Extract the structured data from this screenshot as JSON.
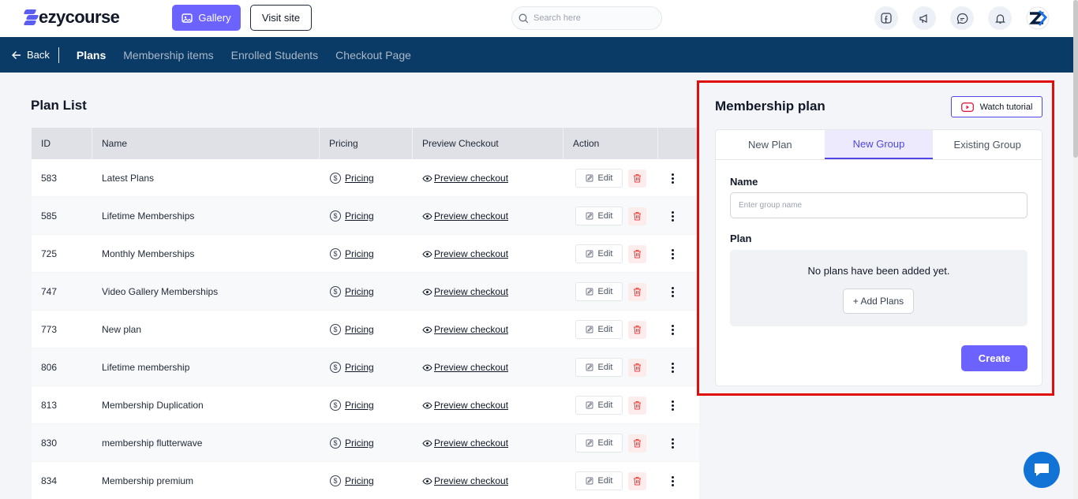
{
  "brand": {
    "logo_text": "ezycourse",
    "accent": "#6c63ff",
    "nav_bg": "#0a3a66",
    "highlight": "#e00d0d"
  },
  "header": {
    "gallery_label": "Gallery",
    "visit_label": "Visit site",
    "search_placeholder": "Search here",
    "icons": [
      "facebook-icon",
      "megaphone-icon",
      "messenger-icon",
      "bell-icon",
      "avatar"
    ]
  },
  "subnav": {
    "back_label": "Back",
    "tabs": [
      "Plans",
      "Membership items",
      "Enrolled Students",
      "Checkout Page"
    ],
    "active": "Plans"
  },
  "plan_list": {
    "title": "Plan List",
    "columns": [
      "ID",
      "Name",
      "Pricing",
      "Preview Checkout",
      "Action"
    ],
    "pricing_label": "Pricing",
    "preview_label": "Preview checkout",
    "edit_label": "Edit",
    "rows": [
      {
        "id": "583",
        "name": "Latest Plans"
      },
      {
        "id": "585",
        "name": "Lifetime Memberships"
      },
      {
        "id": "725",
        "name": "Monthly Memberships"
      },
      {
        "id": "747",
        "name": "Video Gallery Memberships"
      },
      {
        "id": "773",
        "name": "New plan"
      },
      {
        "id": "806",
        "name": "Lifetime membership"
      },
      {
        "id": "813",
        "name": "Membership Duplication"
      },
      {
        "id": "830",
        "name": "membership flutterwave"
      },
      {
        "id": "834",
        "name": "Membership premium"
      }
    ]
  },
  "membership_panel": {
    "title": "Membership plan",
    "watch_label": "Watch tutorial",
    "tabs": [
      "New Plan",
      "New Group",
      "Existing Group"
    ],
    "active_tab": "New Group",
    "name_label": "Name",
    "name_placeholder": "Enter group name",
    "plan_label": "Plan",
    "empty_text": "No plans have been added yet.",
    "add_plans_label": "+ Add Plans",
    "create_label": "Create"
  }
}
